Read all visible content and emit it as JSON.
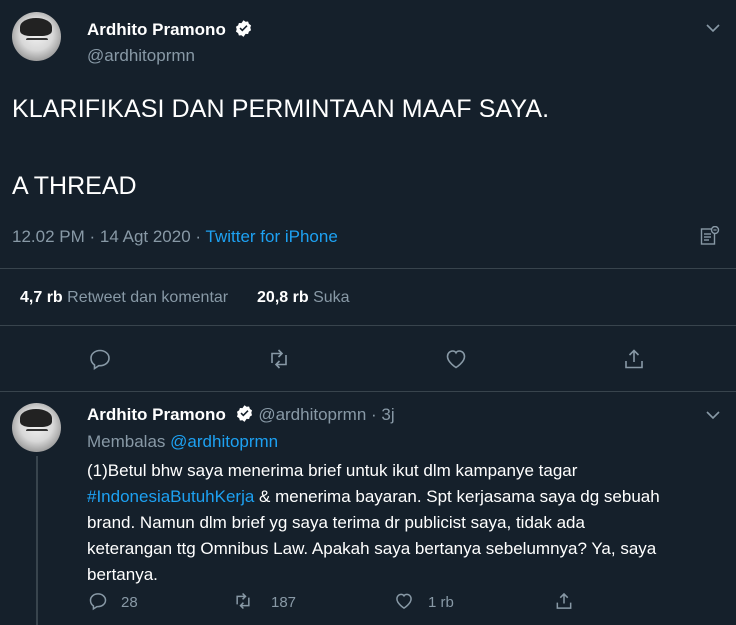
{
  "main_tweet": {
    "display_name": "Ardhito Pramono",
    "handle": "@ardhitoprmn",
    "text_line1": "KLARIFIKASI DAN PERMINTAAN MAAF SAYA.",
    "text_line2": "A THREAD",
    "time": "12.02 PM",
    "date": "14 Agt 2020",
    "separator": "·",
    "source": "Twitter for iPhone",
    "retweet_count": "4,7 rb",
    "retweet_label": "Retweet dan komentar",
    "like_count": "20,8 rb",
    "like_label": "Suka"
  },
  "reply_tweet": {
    "display_name": "Ardhito Pramono",
    "handle": "@ardhitoprmn",
    "separator": "·",
    "age": "3j",
    "replying_to_label": "Membalas",
    "replying_to_handle": "@ardhitoprmn",
    "text_line1": "(1)Betul bhw saya menerima brief untuk ikut dlm kampanye tagar",
    "hashtag": "#IndonesiaButuhKerja",
    "text_line2_rest": " & menerima bayaran. Spt kerjasama saya dg sebuah",
    "text_line3": "brand. Namun dlm brief yg saya terima dr publicist saya, tidak ada",
    "text_line4": "keterangan ttg Omnibus Law. Apakah saya bertanya sebelumnya? Ya, saya",
    "text_line5": "bertanya.",
    "reply_count": "28",
    "retweet_count": "187",
    "like_count": "1 rb"
  },
  "colors": {
    "background": "#15202b",
    "muted": "#8899a6",
    "accent": "#1da1f2",
    "divider": "#38444d"
  },
  "icons": [
    "verified-badge-icon",
    "chevron-down-icon",
    "analytics-icon",
    "reply-icon",
    "retweet-icon",
    "like-icon",
    "share-icon"
  ]
}
